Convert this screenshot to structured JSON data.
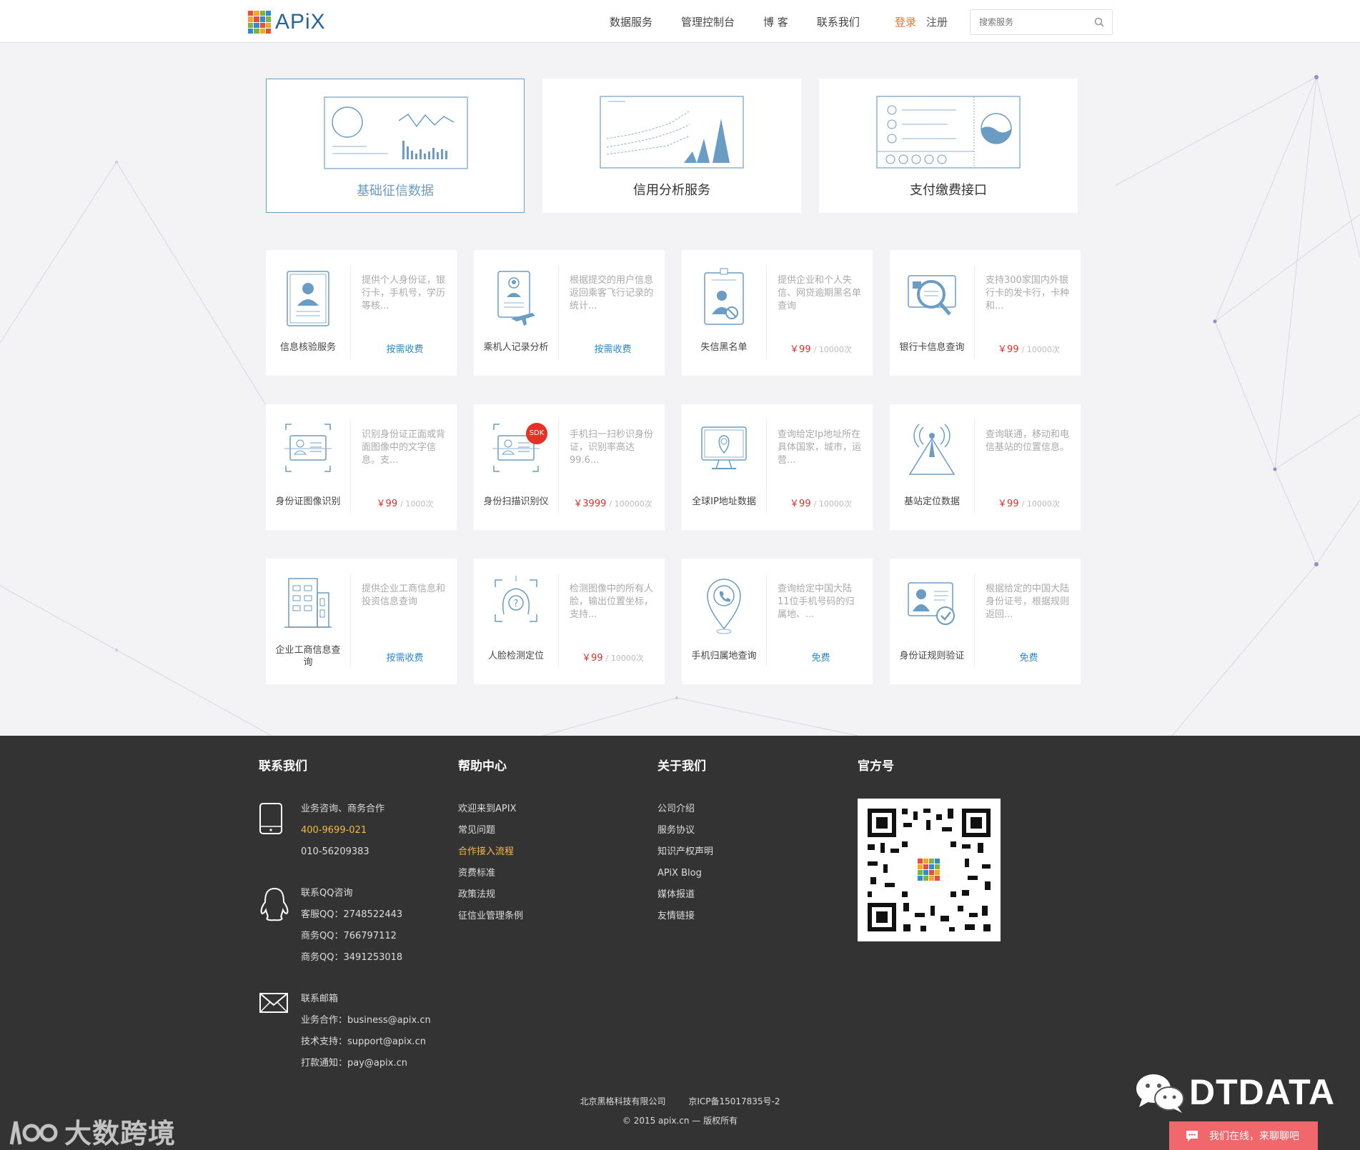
{
  "header": {
    "logo_text": "APiX",
    "nav": [
      "数据服务",
      "管理控制台",
      "博 客",
      "联系我们"
    ],
    "login": "登录",
    "register": "注册",
    "search_placeholder": "搜索服务"
  },
  "categories": [
    {
      "label": "基础征信数据",
      "active": true
    },
    {
      "label": "信用分析服务",
      "active": false
    },
    {
      "label": "支付缴费接口",
      "active": false
    }
  ],
  "services": [
    {
      "name": "信息核验服务",
      "desc": "提供个人身份证，银行卡，手机号，学历等核...",
      "price": {
        "text": "按需收费"
      }
    },
    {
      "name": "乘机人记录分析",
      "desc": "根据提交的用户信息返回乘客飞行记录的统计...",
      "price": {
        "text": "按需收费"
      }
    },
    {
      "name": "失信黑名单",
      "desc": "提供企业和个人失信、网贷逾期黑名单查询",
      "price": {
        "amount": "￥99",
        "unit": "/ 10000次"
      }
    },
    {
      "name": "银行卡信息查询",
      "desc": "支持300家国内外银行卡的发卡行，卡种和...",
      "price": {
        "amount": "￥99",
        "unit": "/ 10000次"
      }
    },
    {
      "name": "身份证图像识别",
      "desc": "识别身份证正面或背面图像中的文字信息。支...",
      "price": {
        "amount": "￥99",
        "unit": "/ 1000次"
      }
    },
    {
      "name": "身份扫描识别仪",
      "desc": "手机扫一扫秒识身份证，识别率高达99.6...",
      "price": {
        "amount": "￥3999",
        "unit": "/ 100000次"
      },
      "badge": "SDK"
    },
    {
      "name": "全球IP地址数据",
      "desc": "查询给定Ip地址所在具体国家，城市，运营...",
      "price": {
        "amount": "￥99",
        "unit": "/ 10000次"
      }
    },
    {
      "name": "基站定位数据",
      "desc": "查询联通，移动和电信基站的位置信息。",
      "price": {
        "amount": "￥99",
        "unit": "/ 10000次"
      }
    },
    {
      "name": "企业工商信息查询",
      "desc": "提供企业工商信息和投资信息查询",
      "price": {
        "text": "按需收费"
      }
    },
    {
      "name": "人脸检测定位",
      "desc": "检测图像中的所有人脸，输出位置坐标，支持...",
      "price": {
        "amount": "￥99",
        "unit": "/ 10000次"
      }
    },
    {
      "name": "手机归属地查询",
      "desc": "查询给定中国大陆11位手机号码的归属地、...",
      "price": {
        "text": "免费"
      }
    },
    {
      "name": "身份证规则验证",
      "desc": "根据给定的中国大陆身份证号，根据规则返回...",
      "price": {
        "text": "免费"
      }
    }
  ],
  "footer": {
    "contact": {
      "title": "联系我们",
      "phone": {
        "label": "业务咨询、商务合作",
        "hotline": "400-9699-021",
        "tel": "010-56209383"
      },
      "qq": {
        "label": "联系QQ咨询",
        "lines": [
          "客服QQ：2748522443",
          "商务QQ：766797112",
          "商务QQ：3491253018"
        ]
      },
      "email": {
        "label": "联系邮箱",
        "lines": [
          "业务合作：business@apix.cn",
          "技术支持：support@apix.cn",
          "打款通知：pay@apix.cn"
        ]
      }
    },
    "help": {
      "title": "帮助中心",
      "links": [
        "欢迎来到APIX",
        "常见问题",
        "合作接入流程",
        "资费标准",
        "政策法规",
        "征信业管理条例"
      ],
      "highlight": 2
    },
    "about": {
      "title": "关于我们",
      "links": [
        "公司介绍",
        "服务协议",
        "知识产权声明",
        "APiX Blog",
        "媒体报道",
        "友情链接"
      ]
    },
    "official": {
      "title": "官方号"
    },
    "company": "北京黑格科技有限公司",
    "icp": "京ICP备15017835号-2",
    "copyright": "© 2015 apix.cn — 版权所有"
  },
  "overlays": {
    "watermark_left": "大数跨境",
    "watermark_right": "DTDATA",
    "chat_button": "我们在线，来聊聊吧"
  },
  "colors": {
    "brand_blue": "#27649a",
    "accent_blue": "#6b9cc4",
    "login_orange": "#e0772a",
    "price_red": "#d9302a",
    "free_blue": "#2a88c9",
    "footer_bg": "#333333",
    "footer_highlight": "#f5b94a",
    "chat_pink": "#f0686b"
  }
}
